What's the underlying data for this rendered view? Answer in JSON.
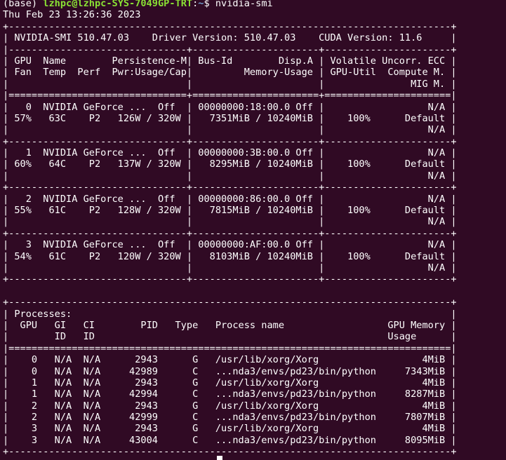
{
  "prompt": {
    "env": "(base) ",
    "user_host": "lzhpc@lzhpc-SYS-7049GP-TRT",
    "separator": ":",
    "path": "~",
    "symbol": "$ ",
    "command": "nvidia-smi"
  },
  "datetime": "Thu Feb 23 13:26:36 2023",
  "smi_header": {
    "border_top": "+-----------------------------------------------------------------------------+",
    "version_line": "| NVIDIA-SMI 510.47.03    Driver Version: 510.47.03    CUDA Version: 11.6     |",
    "divider": "|-------------------------------+----------------------+----------------------+",
    "col_header_1": "| GPU  Name        Persistence-M| Bus-Id        Disp.A | Volatile Uncorr. ECC |",
    "col_header_2": "| Fan  Temp  Perf  Pwr:Usage/Cap|         Memory-Usage | GPU-Util  Compute M. |",
    "col_header_3": "|                               |                      |               MIG M. |",
    "double_divider": "|===============================+======================+======================|"
  },
  "gpus": [
    {
      "line1": "|   0  NVIDIA GeForce ...  Off  | 00000000:18:00.0 Off |                  N/A |",
      "line2": "| 57%   63C    P2   126W / 320W |   7351MiB / 10240MiB |    100%      Default |",
      "line3": "|                               |                      |                  N/A |",
      "sep": "+-------------------------------+----------------------+----------------------+"
    },
    {
      "line1": "|   1  NVIDIA GeForce ...  Off  | 00000000:3B:00.0 Off |                  N/A |",
      "line2": "| 60%   64C    P2   137W / 320W |   8295MiB / 10240MiB |    100%      Default |",
      "line3": "|                               |                      |                  N/A |",
      "sep": "+-------------------------------+----------------------+----------------------+"
    },
    {
      "line1": "|   2  NVIDIA GeForce ...  Off  | 00000000:86:00.0 Off |                  N/A |",
      "line2": "| 55%   61C    P2   128W / 320W |   7815MiB / 10240MiB |    100%      Default |",
      "line3": "|                               |                      |                  N/A |",
      "sep": "+-------------------------------+----------------------+----------------------+"
    },
    {
      "line1": "|   3  NVIDIA GeForce ...  Off  | 00000000:AF:00.0 Off |                  N/A |",
      "line2": "| 54%   61C    P2   120W / 320W |   8103MiB / 10240MiB |    100%      Default |",
      "line3": "|                               |                      |                  N/A |",
      "sep": "+-------------------------------+----------------------+----------------------+"
    }
  ],
  "processes": {
    "border_top": "+-----------------------------------------------------------------------------+",
    "title": "| Processes:                                                                  |",
    "header_1": "|  GPU   GI   CI        PID   Type   Process name                  GPU Memory |",
    "header_2": "|        ID   ID                                                   Usage      |",
    "double_divider": "|=============================================================================|",
    "rows": [
      "|    0   N/A  N/A      2943      G   /usr/lib/xorg/Xorg                  4MiB |",
      "|    0   N/A  N/A     42989      C   ...nda3/envs/pd23/bin/python     7343MiB |",
      "|    1   N/A  N/A      2943      G   /usr/lib/xorg/Xorg                  4MiB |",
      "|    1   N/A  N/A     42994      C   ...nda3/envs/pd23/bin/python     8287MiB |",
      "|    2   N/A  N/A      2943      G   /usr/lib/xorg/Xorg                  4MiB |",
      "|    2   N/A  N/A     42999      C   ...nda3/envs/pd23/bin/python     7807MiB |",
      "|    3   N/A  N/A      2943      G   /usr/lib/xorg/Xorg                  4MiB |",
      "|    3   N/A  N/A     43004      C   ...nda3/envs/pd23/bin/python     8095MiB |"
    ],
    "border_bottom": "+-----------------------------------------------------------------------------+"
  },
  "colors": {
    "background": "#300a24",
    "text": "#ffffff",
    "prompt_user": "#8ae234",
    "prompt_path": "#729fcf"
  }
}
